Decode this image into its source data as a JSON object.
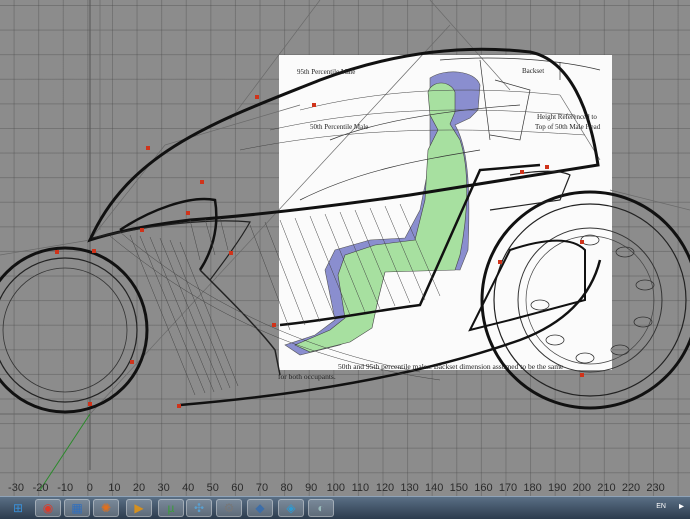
{
  "reference_sheet": {
    "label_95th": "95th Percentile Male",
    "label_50th": "50th Percentile Male",
    "label_backset": "Backset",
    "label_height_line1": "Height Referenced to",
    "label_height_line2": "Top of 50th Male Head",
    "caption_line1": "50th and 95th percentile males. Backset dimension assumed to be the same",
    "caption_line2": "for both occupants."
  },
  "ruler": {
    "ticks": [
      "-30",
      "-20",
      "-10",
      "0",
      "10",
      "20",
      "30",
      "40",
      "50",
      "60",
      "70",
      "80",
      "90",
      "100",
      "110",
      "120",
      "130",
      "140",
      "150",
      "160",
      "170",
      "180",
      "190",
      "200",
      "210",
      "220",
      "230"
    ]
  },
  "taskbar": {
    "items": [
      {
        "name": "start-orb-icon",
        "glyph": "⊞",
        "color": "#3a8fd6"
      },
      {
        "name": "chrome-icon",
        "glyph": "◉",
        "color": "#d93b2b"
      },
      {
        "name": "windows-icon",
        "glyph": "▦",
        "color": "#2f6fbf"
      },
      {
        "name": "firefox-icon",
        "glyph": "✺",
        "color": "#e2701c"
      },
      {
        "name": "media-player-icon",
        "glyph": "▶",
        "color": "#d49020"
      },
      {
        "name": "utorrent-icon",
        "glyph": "µ",
        "color": "#3c9c3c"
      },
      {
        "name": "network-icon",
        "glyph": "✣",
        "color": "#5aa0d0"
      },
      {
        "name": "motorcycle-app-icon",
        "glyph": "⚙",
        "color": "#777"
      },
      {
        "name": "3d-modeler-icon",
        "glyph": "◆",
        "color": "#3d6ea8"
      },
      {
        "name": "graphics-app-icon",
        "glyph": "◈",
        "color": "#2f9bd2"
      },
      {
        "name": "folder-icon",
        "glyph": "◐",
        "color": "#9bb"
      }
    ],
    "language": "EN",
    "tray_arrow": "▸"
  }
}
